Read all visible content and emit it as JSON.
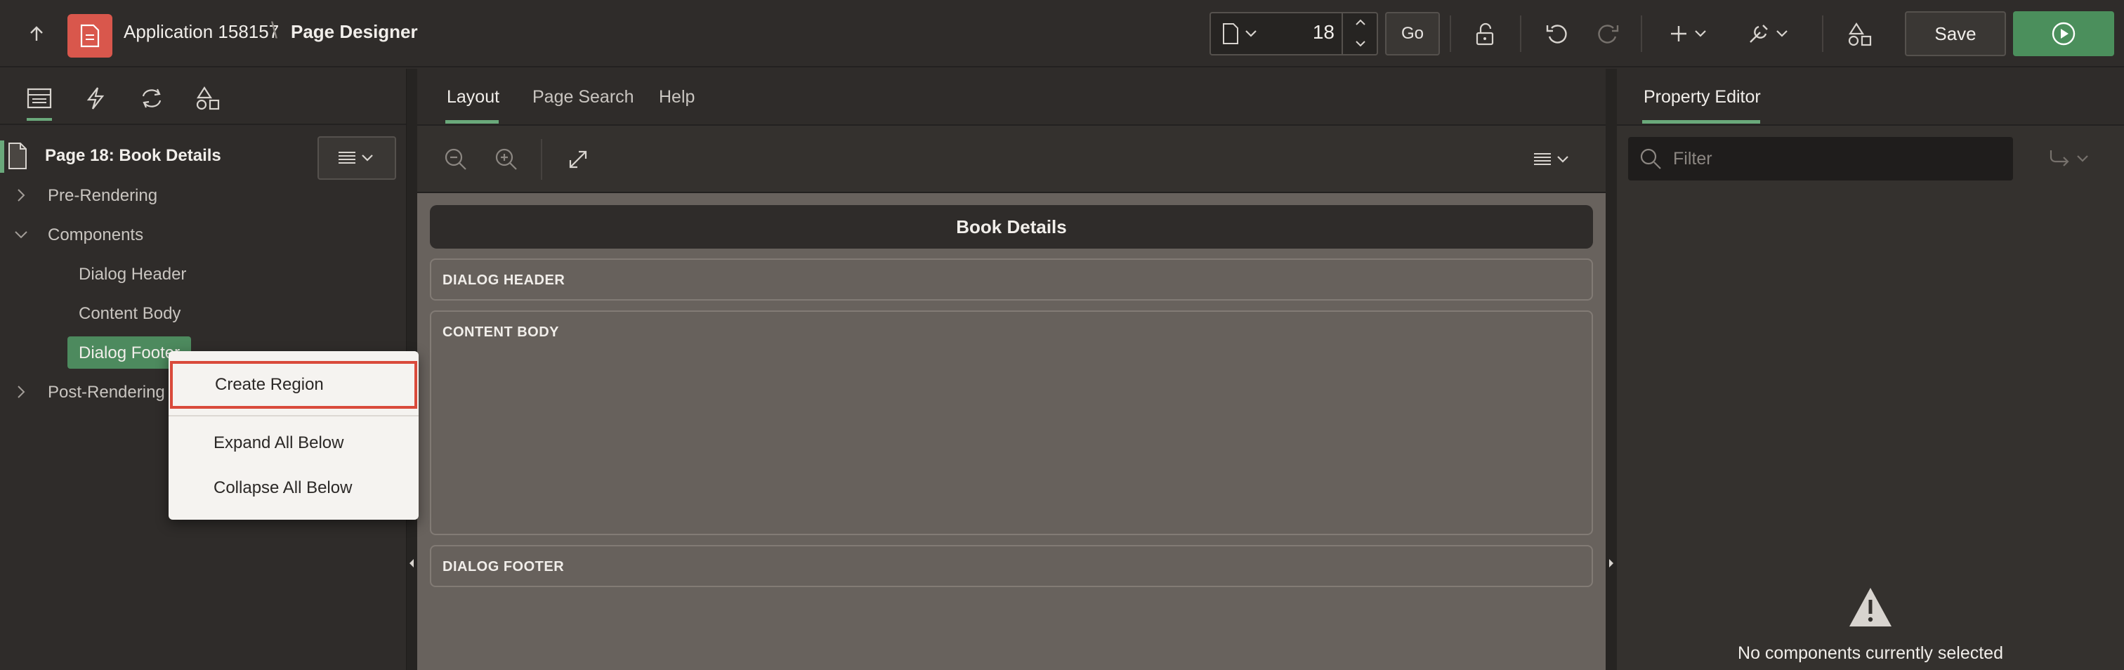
{
  "header": {
    "app_label": "Application 158157",
    "separator": "\\",
    "page_label": "Page Designer",
    "page_number": "18",
    "go_label": "Go",
    "save_label": "Save"
  },
  "left_panel": {
    "tabs": [
      "rendering-tab",
      "dynamic-actions-tab",
      "processing-tab",
      "shared-components-tab"
    ],
    "tree": {
      "root": "Page 18: Book Details",
      "nodes": [
        {
          "label": "Pre-Rendering",
          "state": "collapsed"
        },
        {
          "label": "Components",
          "state": "expanded"
        },
        {
          "label": "Dialog Header"
        },
        {
          "label": "Content Body"
        },
        {
          "label": "Dialog Footer",
          "selected": true
        },
        {
          "label": "Post-Rendering",
          "state": "collapsed"
        }
      ]
    }
  },
  "context_menu": {
    "items": [
      "Create Region",
      "Expand All Below",
      "Collapse All Below"
    ],
    "highlighted": "Create Region"
  },
  "center_panel": {
    "tabs": [
      "Layout",
      "Page Search",
      "Help"
    ],
    "active_tab": "Layout",
    "page_title": "Book Details",
    "regions": [
      "DIALOG HEADER",
      "CONTENT BODY",
      "DIALOG FOOTER"
    ]
  },
  "right_panel": {
    "tab": "Property Editor",
    "filter_placeholder": "Filter",
    "empty_message": "No components currently selected"
  },
  "colors": {
    "accent_green": "#4b8f5c",
    "highlight_red": "#d94a3b",
    "app_icon_red": "#d9574c"
  }
}
